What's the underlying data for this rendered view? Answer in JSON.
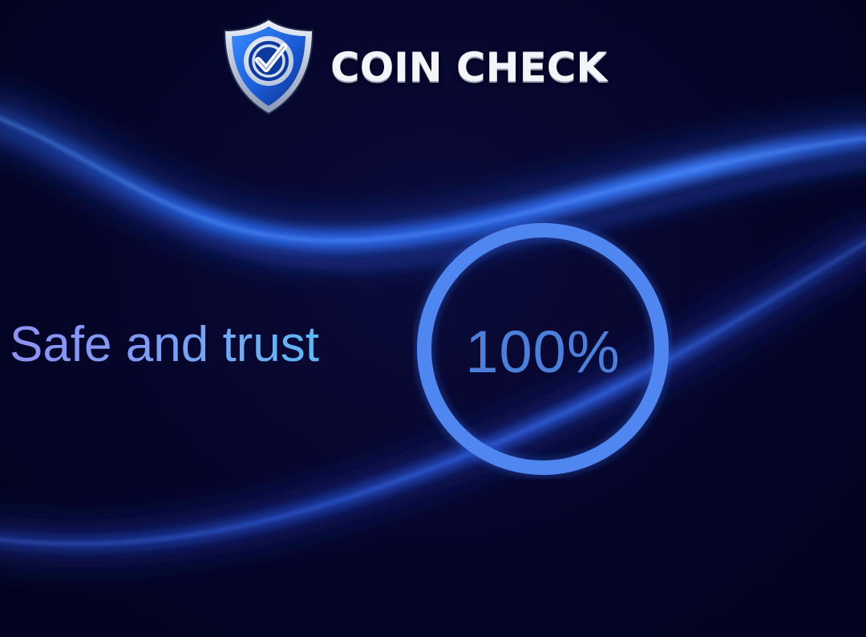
{
  "brand": {
    "name": "COIN CHECK",
    "logo_icon": "shield-check-icon"
  },
  "tagline": "Safe and trust",
  "gauge": {
    "value_text": "100%",
    "progress": 1.0,
    "ring_color": "#4f86f0"
  },
  "colors": {
    "background": "#05052a",
    "wave_highlight": "#3a78ff",
    "tagline_start": "#8e92f2",
    "tagline_end": "#5fb8f4"
  }
}
